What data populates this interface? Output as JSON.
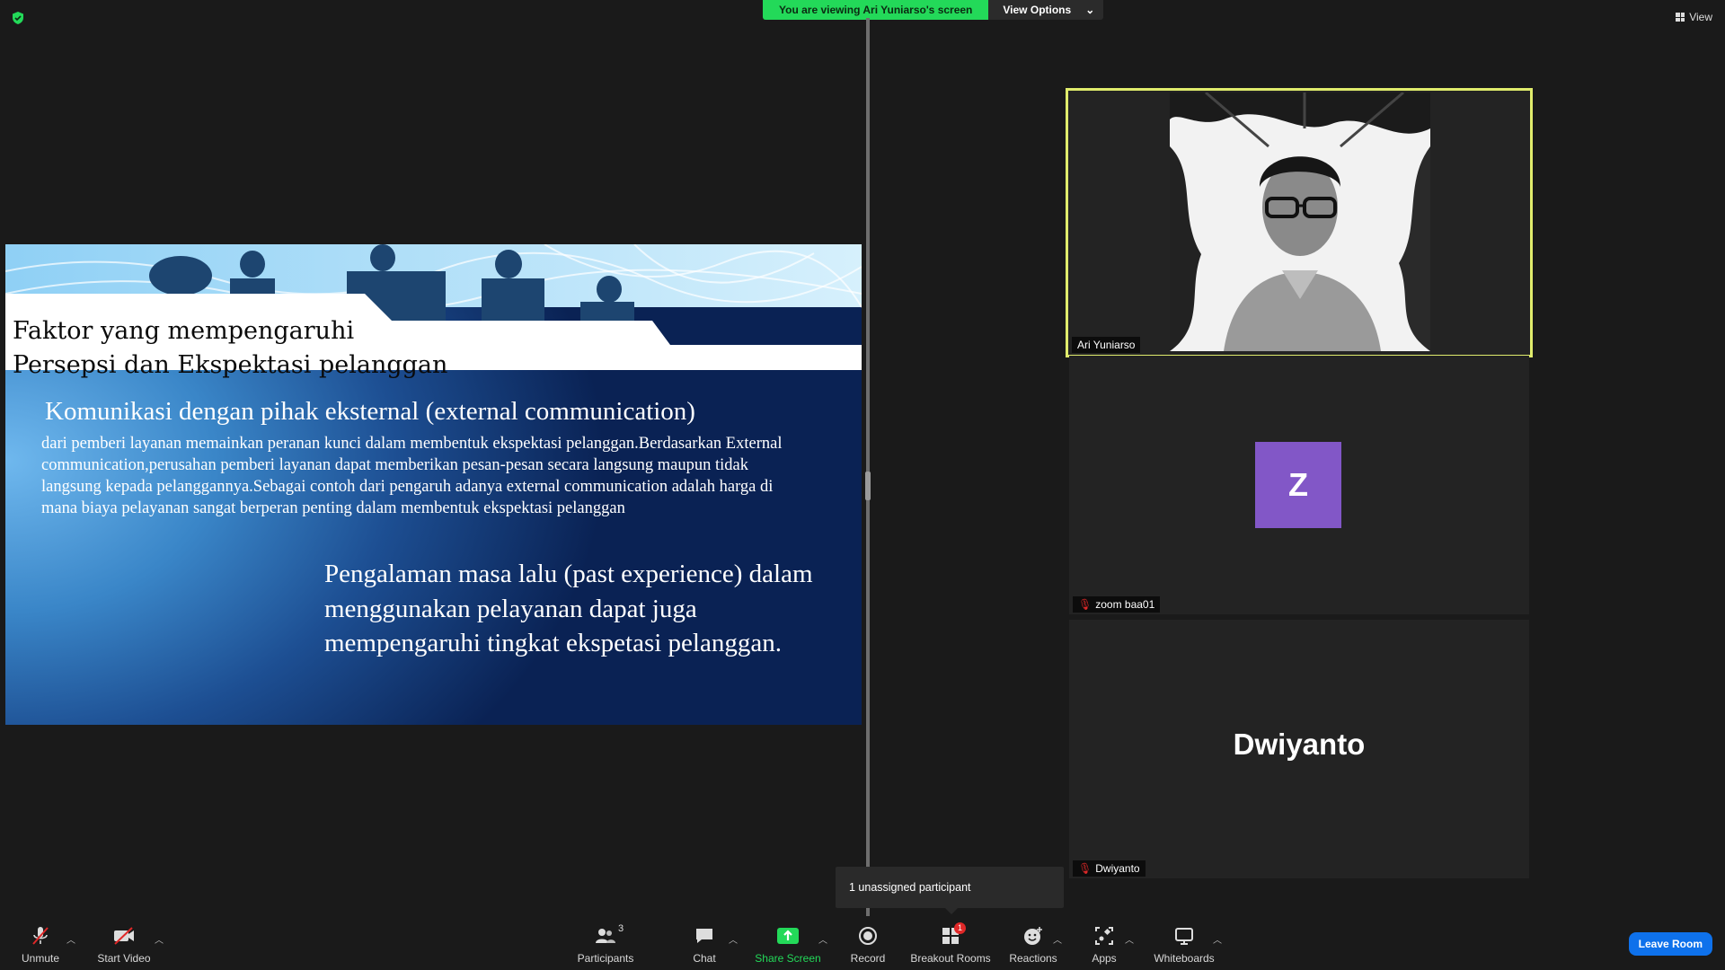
{
  "banner": {
    "viewing_text": "You are viewing Ari  Yuniarso's screen",
    "view_options": "View Options"
  },
  "top_right": {
    "view_label": "View"
  },
  "slide": {
    "title": "Faktor yang mempengaruhi\nPersepsi dan Ekspektasi pelanggan",
    "heading": "Komunikasi dengan pihak eksternal (external communication)",
    "body": "dari pemberi layanan memainkan peranan kunci dalam membentuk ekspektasi pelanggan.Berdasarkan External communication,perusahan pemberi layanan dapat memberikan pesan-pesan secara langsung maupun tidak langsung kepada pelanggannya.Sebagai contoh dari pengaruh adanya external communication  adalah harga di mana biaya pelayanan sangat berperan penting dalam membentuk ekspektasi pelanggan",
    "quote": "Pengalaman masa lalu (past experience) dalam menggunakan pelayanan dapat juga mempengaruhi tingkat ekspetasi pelanggan."
  },
  "participants": [
    {
      "name": "Ari  Yuniarso",
      "muted": false,
      "active_speaker": true
    },
    {
      "name": "zoom baa01",
      "muted": true,
      "avatar_letter": "Z",
      "avatar_color": "#8257c7"
    },
    {
      "name": "Dwiyanto",
      "muted": true,
      "display_name": "Dwiyanto"
    }
  ],
  "tooltip": {
    "text": "1 unassigned participant"
  },
  "toolbar": {
    "unmute": "Unmute",
    "start_video": "Start Video",
    "participants": "Participants",
    "participants_count": "3",
    "chat": "Chat",
    "share_screen": "Share Screen",
    "record": "Record",
    "breakout_rooms": "Breakout Rooms",
    "breakout_badge": "1",
    "reactions": "Reactions",
    "apps": "Apps",
    "whiteboards": "Whiteboards",
    "leave": "Leave Room"
  },
  "colors": {
    "share_green": "#23d959",
    "speaker_border": "#e0ec6c",
    "leave_blue": "#0e71eb",
    "muted_red": "#e02828"
  }
}
